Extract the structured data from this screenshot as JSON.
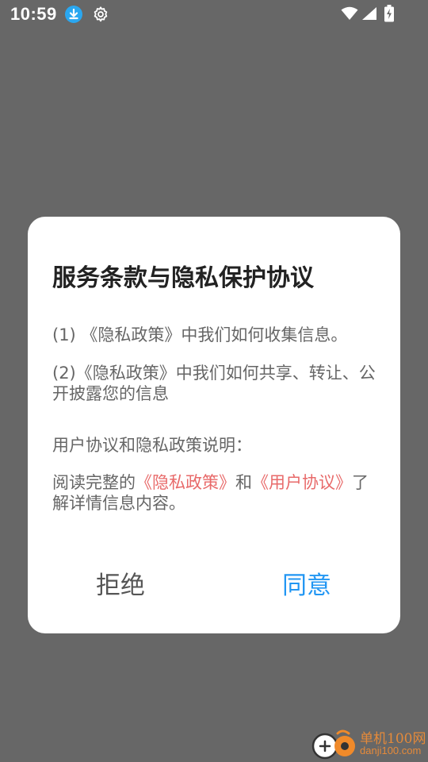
{
  "status_bar": {
    "time": "10:59"
  },
  "dialog": {
    "title": "服务条款与隐私保护协议",
    "p1": "(1) 《隐私政策》中我们如何收集信息。",
    "p2": "(2)《隐私政策》中我们如何共享、转让、公开披露您的信息",
    "p3": "用户协议和隐私政策说明：",
    "p4_prefix": "阅读完整的",
    "p4_link_privacy": "《隐私政策》",
    "p4_and": "和",
    "p4_link_user": "《用户协议》",
    "p4_suffix": "了解详情信息内容。",
    "reject_label": "拒绝",
    "agree_label": "同意"
  },
  "watermark": {
    "name": "单机100网",
    "domain": "danji100.com"
  },
  "colors": {
    "overlay": "#676767",
    "link": "#e86a6a",
    "agree": "#2196f3",
    "download_badge": "#2aa7f0",
    "watermark": "#e58a3a"
  }
}
